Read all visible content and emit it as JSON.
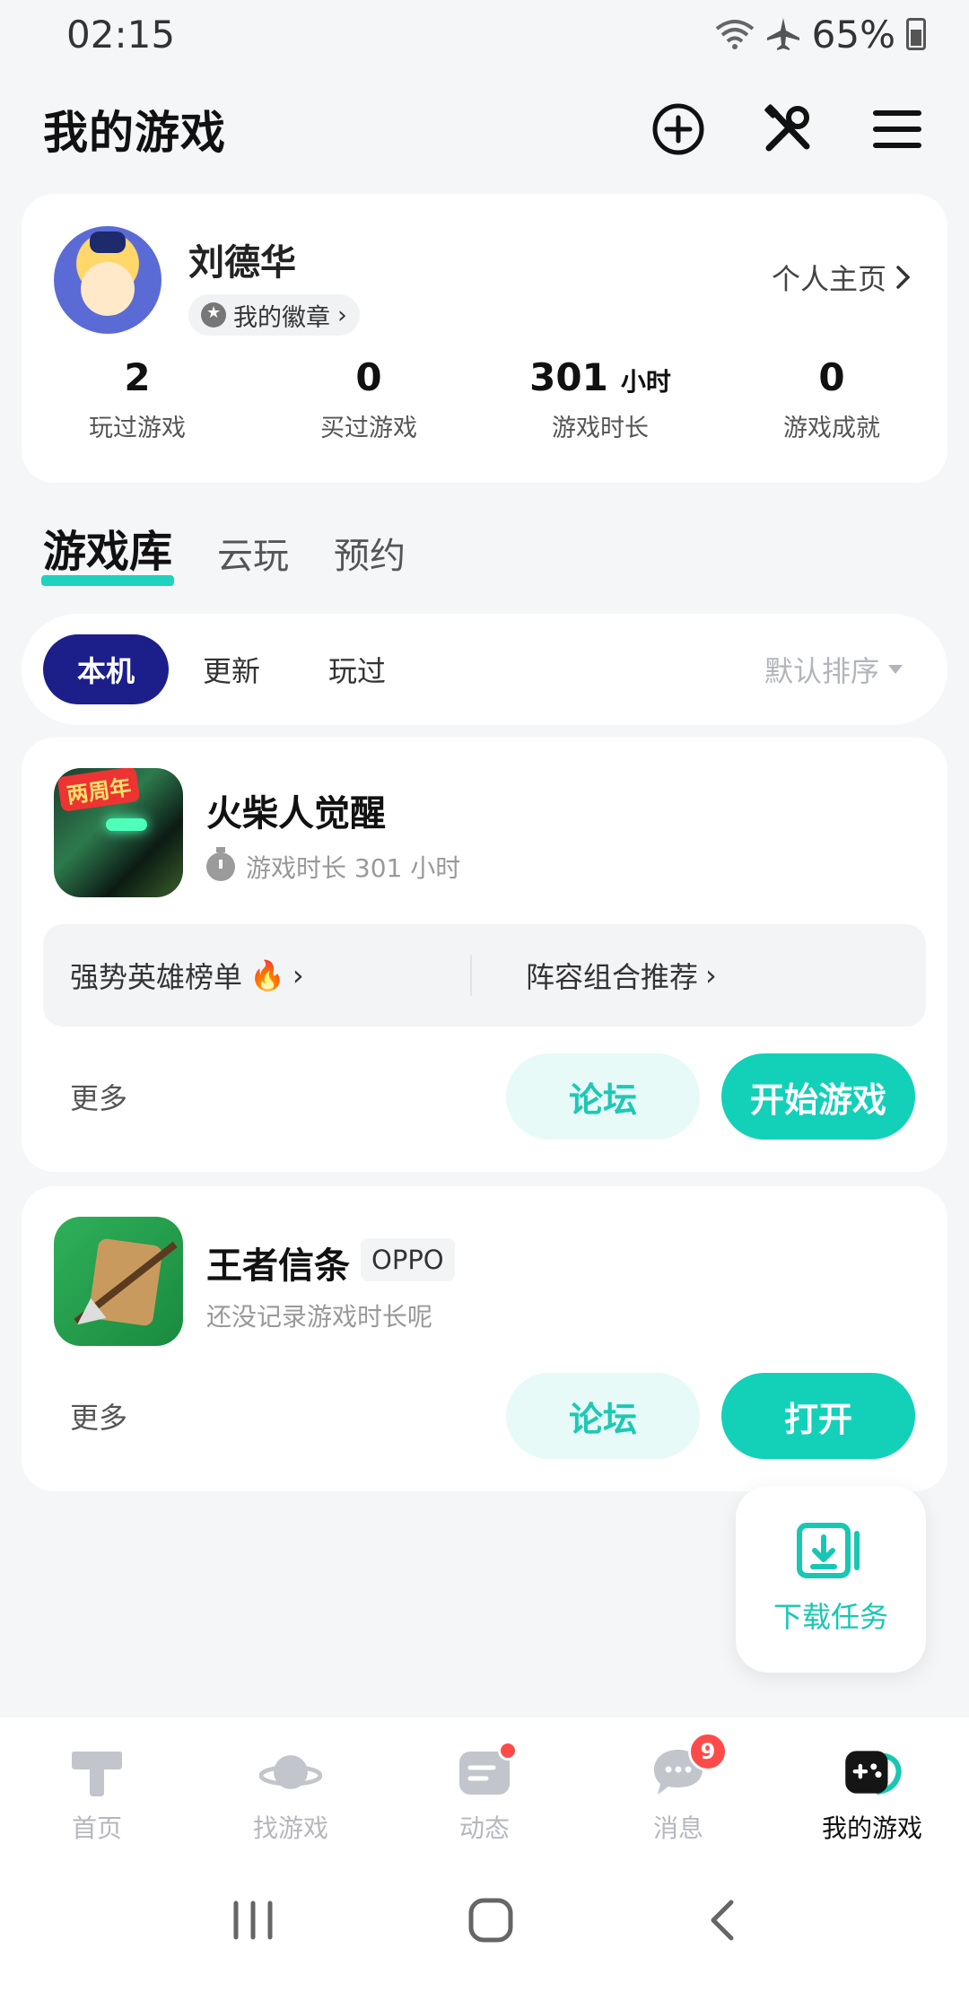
{
  "status_bar": {
    "time": "02:15",
    "battery": "65%"
  },
  "header": {
    "title": "我的游戏"
  },
  "profile": {
    "name": "刘德华",
    "badge_label": "我的徽章",
    "homepage_link": "个人主页",
    "stats": [
      {
        "value": "2",
        "unit": "",
        "label": "玩过游戏"
      },
      {
        "value": "0",
        "unit": "",
        "label": "买过游戏"
      },
      {
        "value": "301",
        "unit": "小时",
        "label": "游戏时长"
      },
      {
        "value": "0",
        "unit": "",
        "label": "游戏成就"
      }
    ]
  },
  "library_tabs": [
    {
      "label": "游戏库",
      "active": true
    },
    {
      "label": "云玩",
      "active": false
    },
    {
      "label": "预约",
      "active": false
    }
  ],
  "filters": {
    "chips": [
      {
        "label": "本机",
        "active": true
      },
      {
        "label": "更新",
        "active": false
      },
      {
        "label": "玩过",
        "active": false
      }
    ],
    "sort_label": "默认排序"
  },
  "games": [
    {
      "icon_tag": "两周年",
      "name": "火柴人觉醒",
      "playtime": "游戏时长 301 小时",
      "links": [
        "强势英雄榜单",
        "阵容组合推荐"
      ],
      "more_label": "更多",
      "forum_label": "论坛",
      "primary_label": "开始游戏"
    },
    {
      "name": "王者信条",
      "tag": "OPPO",
      "playtime": "还没记录游戏时长呢",
      "more_label": "更多",
      "forum_label": "论坛",
      "primary_label": "打开"
    }
  ],
  "download_task": {
    "label": "下载任务"
  },
  "bottom_nav": [
    {
      "label": "首页",
      "icon": "home-icon",
      "active": false
    },
    {
      "label": "找游戏",
      "icon": "planet-icon",
      "active": false
    },
    {
      "label": "动态",
      "icon": "feed-icon",
      "active": false,
      "dot": true
    },
    {
      "label": "消息",
      "icon": "chat-icon",
      "active": false,
      "count": "9"
    },
    {
      "label": "我的游戏",
      "icon": "gamepad-icon",
      "active": true
    }
  ],
  "colors": {
    "accent": "#13d0b9",
    "chip_active": "#1c1f8a",
    "badge_red": "#ff4a4a"
  }
}
